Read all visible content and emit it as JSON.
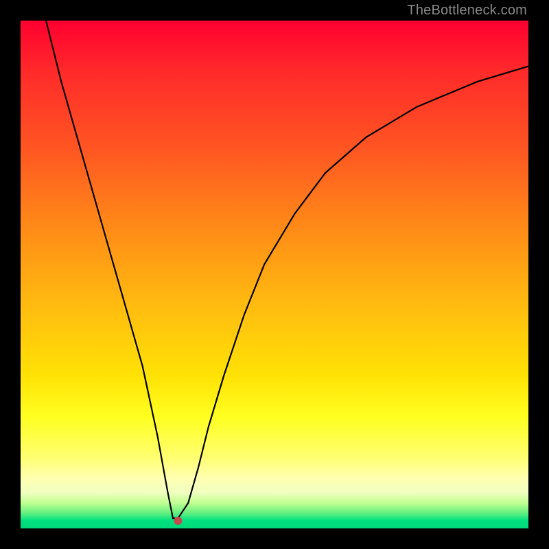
{
  "watermark": "TheBottleneck.com",
  "chart_data": {
    "type": "line",
    "title": "",
    "xlabel": "",
    "ylabel": "",
    "xlim": [
      0,
      100
    ],
    "ylim": [
      0,
      100
    ],
    "grid": false,
    "legend": false,
    "series": [
      {
        "name": "bottleneck-curve",
        "x": [
          5,
          8,
          12,
          16,
          20,
          24,
          27,
          29,
          30,
          31,
          33,
          35,
          37,
          40,
          44,
          48,
          54,
          60,
          68,
          78,
          90,
          100
        ],
        "y": [
          100,
          88,
          74,
          60,
          46,
          32,
          18,
          7,
          2,
          2,
          5,
          12,
          20,
          30,
          42,
          52,
          62,
          70,
          77,
          83,
          88,
          91
        ]
      }
    ],
    "marker": {
      "x": 31,
      "y": 1.5,
      "color": "#c24a4a"
    },
    "background_gradient_stops": [
      {
        "pos": 0.0,
        "color": "#ff0030"
      },
      {
        "pos": 0.4,
        "color": "#ff8818"
      },
      {
        "pos": 0.78,
        "color": "#ffff20"
      },
      {
        "pos": 0.93,
        "color": "#f0ffc0"
      },
      {
        "pos": 1.0,
        "color": "#00d878"
      }
    ]
  }
}
